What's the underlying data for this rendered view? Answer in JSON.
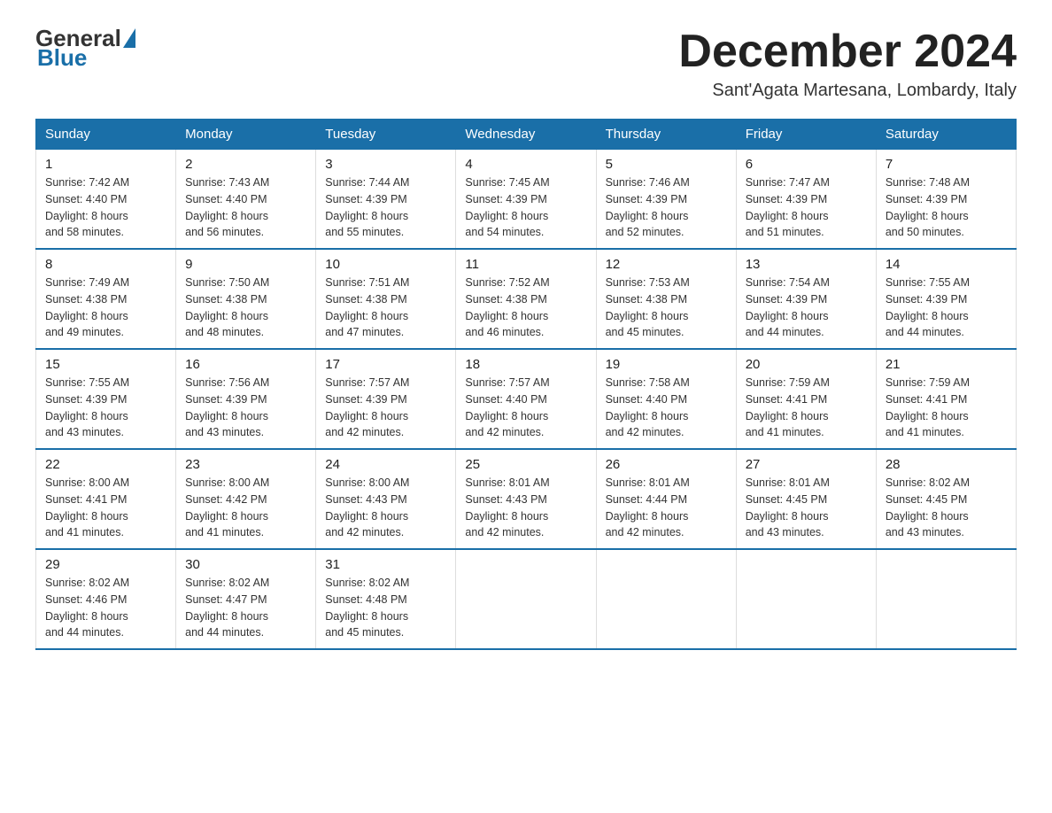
{
  "logo": {
    "general": "General",
    "blue": "Blue"
  },
  "header": {
    "month_year": "December 2024",
    "location": "Sant'Agata Martesana, Lombardy, Italy"
  },
  "days_of_week": [
    "Sunday",
    "Monday",
    "Tuesday",
    "Wednesday",
    "Thursday",
    "Friday",
    "Saturday"
  ],
  "weeks": [
    [
      {
        "day": "1",
        "sunrise": "7:42 AM",
        "sunset": "4:40 PM",
        "daylight": "8 hours and 58 minutes."
      },
      {
        "day": "2",
        "sunrise": "7:43 AM",
        "sunset": "4:40 PM",
        "daylight": "8 hours and 56 minutes."
      },
      {
        "day": "3",
        "sunrise": "7:44 AM",
        "sunset": "4:39 PM",
        "daylight": "8 hours and 55 minutes."
      },
      {
        "day": "4",
        "sunrise": "7:45 AM",
        "sunset": "4:39 PM",
        "daylight": "8 hours and 54 minutes."
      },
      {
        "day": "5",
        "sunrise": "7:46 AM",
        "sunset": "4:39 PM",
        "daylight": "8 hours and 52 minutes."
      },
      {
        "day": "6",
        "sunrise": "7:47 AM",
        "sunset": "4:39 PM",
        "daylight": "8 hours and 51 minutes."
      },
      {
        "day": "7",
        "sunrise": "7:48 AM",
        "sunset": "4:39 PM",
        "daylight": "8 hours and 50 minutes."
      }
    ],
    [
      {
        "day": "8",
        "sunrise": "7:49 AM",
        "sunset": "4:38 PM",
        "daylight": "8 hours and 49 minutes."
      },
      {
        "day": "9",
        "sunrise": "7:50 AM",
        "sunset": "4:38 PM",
        "daylight": "8 hours and 48 minutes."
      },
      {
        "day": "10",
        "sunrise": "7:51 AM",
        "sunset": "4:38 PM",
        "daylight": "8 hours and 47 minutes."
      },
      {
        "day": "11",
        "sunrise": "7:52 AM",
        "sunset": "4:38 PM",
        "daylight": "8 hours and 46 minutes."
      },
      {
        "day": "12",
        "sunrise": "7:53 AM",
        "sunset": "4:38 PM",
        "daylight": "8 hours and 45 minutes."
      },
      {
        "day": "13",
        "sunrise": "7:54 AM",
        "sunset": "4:39 PM",
        "daylight": "8 hours and 44 minutes."
      },
      {
        "day": "14",
        "sunrise": "7:55 AM",
        "sunset": "4:39 PM",
        "daylight": "8 hours and 44 minutes."
      }
    ],
    [
      {
        "day": "15",
        "sunrise": "7:55 AM",
        "sunset": "4:39 PM",
        "daylight": "8 hours and 43 minutes."
      },
      {
        "day": "16",
        "sunrise": "7:56 AM",
        "sunset": "4:39 PM",
        "daylight": "8 hours and 43 minutes."
      },
      {
        "day": "17",
        "sunrise": "7:57 AM",
        "sunset": "4:39 PM",
        "daylight": "8 hours and 42 minutes."
      },
      {
        "day": "18",
        "sunrise": "7:57 AM",
        "sunset": "4:40 PM",
        "daylight": "8 hours and 42 minutes."
      },
      {
        "day": "19",
        "sunrise": "7:58 AM",
        "sunset": "4:40 PM",
        "daylight": "8 hours and 42 minutes."
      },
      {
        "day": "20",
        "sunrise": "7:59 AM",
        "sunset": "4:41 PM",
        "daylight": "8 hours and 41 minutes."
      },
      {
        "day": "21",
        "sunrise": "7:59 AM",
        "sunset": "4:41 PM",
        "daylight": "8 hours and 41 minutes."
      }
    ],
    [
      {
        "day": "22",
        "sunrise": "8:00 AM",
        "sunset": "4:41 PM",
        "daylight": "8 hours and 41 minutes."
      },
      {
        "day": "23",
        "sunrise": "8:00 AM",
        "sunset": "4:42 PM",
        "daylight": "8 hours and 41 minutes."
      },
      {
        "day": "24",
        "sunrise": "8:00 AM",
        "sunset": "4:43 PM",
        "daylight": "8 hours and 42 minutes."
      },
      {
        "day": "25",
        "sunrise": "8:01 AM",
        "sunset": "4:43 PM",
        "daylight": "8 hours and 42 minutes."
      },
      {
        "day": "26",
        "sunrise": "8:01 AM",
        "sunset": "4:44 PM",
        "daylight": "8 hours and 42 minutes."
      },
      {
        "day": "27",
        "sunrise": "8:01 AM",
        "sunset": "4:45 PM",
        "daylight": "8 hours and 43 minutes."
      },
      {
        "day": "28",
        "sunrise": "8:02 AM",
        "sunset": "4:45 PM",
        "daylight": "8 hours and 43 minutes."
      }
    ],
    [
      {
        "day": "29",
        "sunrise": "8:02 AM",
        "sunset": "4:46 PM",
        "daylight": "8 hours and 44 minutes."
      },
      {
        "day": "30",
        "sunrise": "8:02 AM",
        "sunset": "4:47 PM",
        "daylight": "8 hours and 44 minutes."
      },
      {
        "day": "31",
        "sunrise": "8:02 AM",
        "sunset": "4:48 PM",
        "daylight": "8 hours and 45 minutes."
      },
      null,
      null,
      null,
      null
    ]
  ],
  "labels": {
    "sunrise": "Sunrise:",
    "sunset": "Sunset:",
    "daylight": "Daylight:"
  }
}
